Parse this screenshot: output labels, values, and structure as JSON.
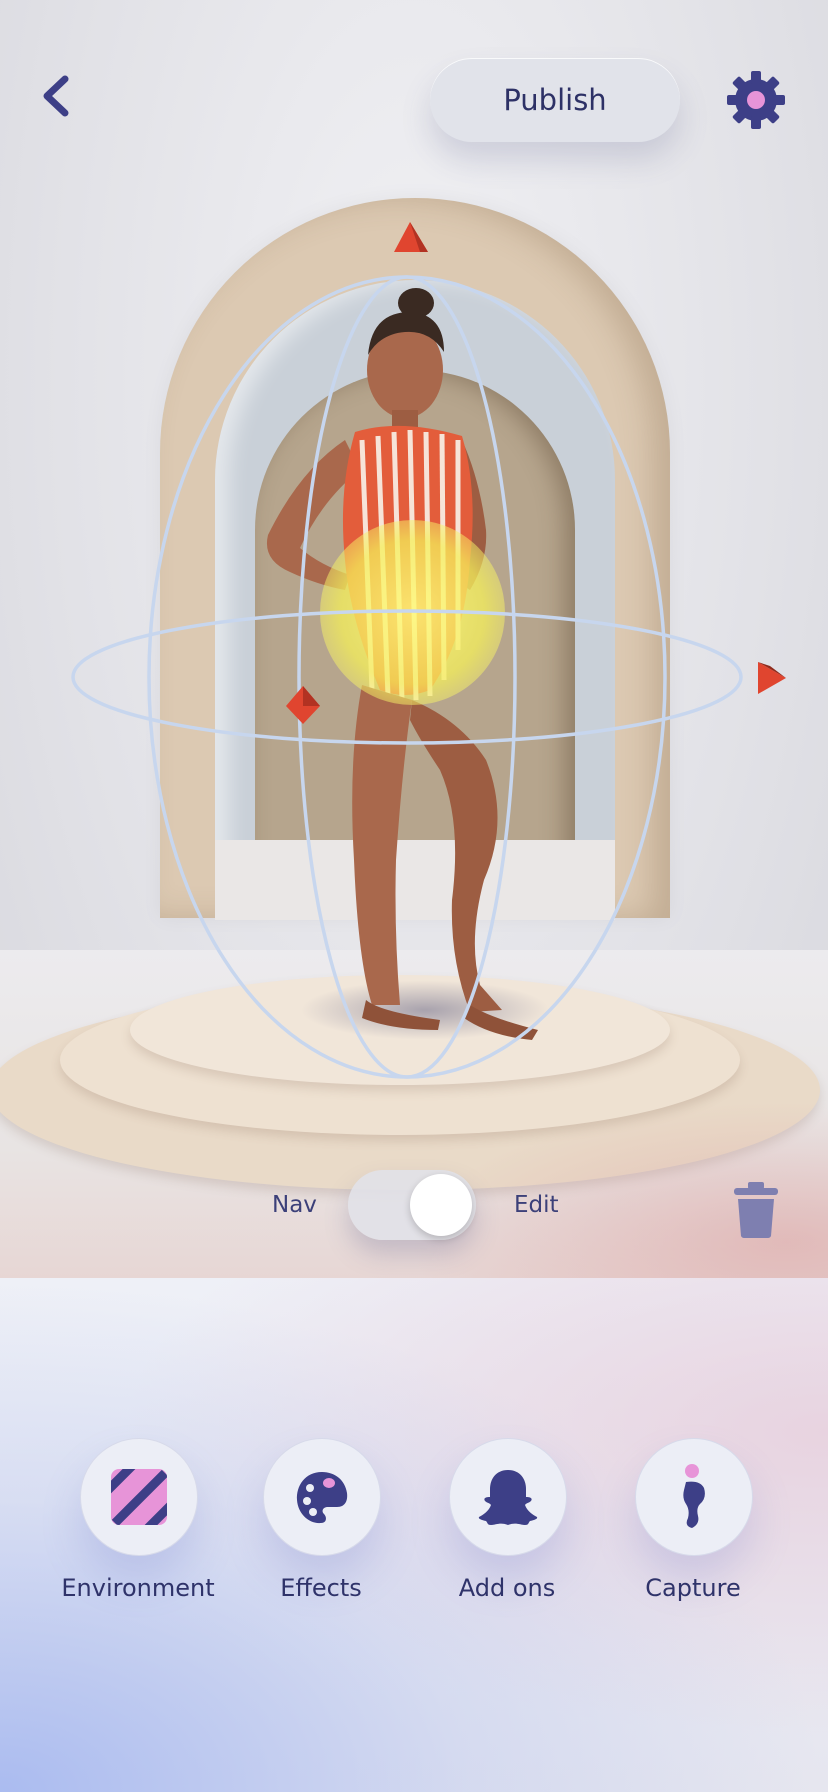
{
  "header": {
    "back_icon": "chevron-left-icon",
    "publish_label": "Publish",
    "settings_icon": "gear-icon"
  },
  "colors": {
    "accent": "#3d3f87",
    "accent_pink": "#e794d8",
    "gizmo_handle": "#e0452f",
    "highlight_glow": "#f4ef6a"
  },
  "mode_toggle": {
    "left_label": "Nav",
    "right_label": "Edit",
    "state": "Edit"
  },
  "delete_icon": "trash-icon",
  "tools": [
    {
      "label": "Environment",
      "icon": "striped-square-icon"
    },
    {
      "label": "Effects",
      "icon": "palette-icon"
    },
    {
      "label": "Add ons",
      "icon": "ghost-icon"
    },
    {
      "label": "Capture",
      "icon": "person-capture-icon"
    }
  ]
}
